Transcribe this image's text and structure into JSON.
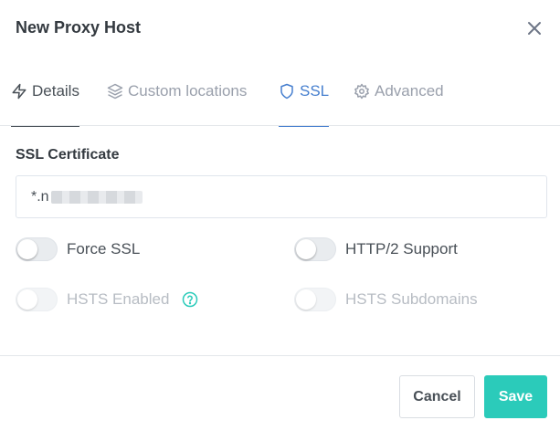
{
  "modal": {
    "title": "New Proxy Host",
    "close_icon": "close-icon"
  },
  "tabs": [
    {
      "label": "Details",
      "icon": "bolt-icon",
      "active": false
    },
    {
      "label": "Custom locations",
      "icon": "layers-icon",
      "active": false
    },
    {
      "label": "SSL",
      "icon": "shield-icon",
      "active": true
    },
    {
      "label": "Advanced",
      "icon": "gear-icon",
      "active": false
    }
  ],
  "ssl": {
    "certificate_label": "SSL Certificate",
    "certificate_value": "*.n",
    "toggles": {
      "force_ssl": {
        "label": "Force SSL",
        "on": false,
        "disabled": false
      },
      "http2": {
        "label": "HTTP/2 Support",
        "on": false,
        "disabled": false
      },
      "hsts_enabled": {
        "label": "HSTS Enabled",
        "on": false,
        "disabled": true
      },
      "hsts_subdomains": {
        "label": "HSTS Subdomains",
        "on": false,
        "disabled": true
      }
    }
  },
  "footer": {
    "cancel_label": "Cancel",
    "save_label": "Save"
  },
  "colors": {
    "accent": "#467fcf",
    "save": "#2bcbba",
    "help": "#2bcbba"
  }
}
